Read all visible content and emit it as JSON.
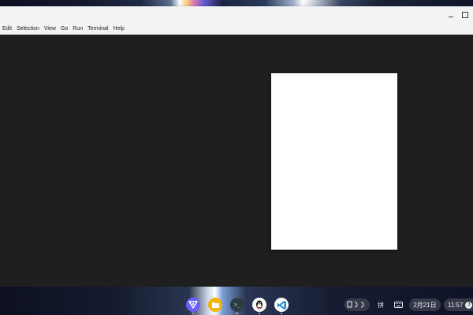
{
  "window": {
    "controls": {
      "minimize_glyph": "_",
      "maximize_icon": "maximize-icon"
    }
  },
  "menu_bar": {
    "items": [
      {
        "label": "Edit"
      },
      {
        "label": "Selection"
      },
      {
        "label": "View"
      },
      {
        "label": "Go"
      },
      {
        "label": "Run"
      },
      {
        "label": "Terminal"
      },
      {
        "label": "Help"
      }
    ]
  },
  "colors": {
    "editor_background": "#1f1f1f",
    "title_bar": "#f1f3f4",
    "page_preview": "#ffffff"
  },
  "shelf": {
    "apps": [
      {
        "name": "app-launcher-icon",
        "color": "#6b5cff"
      },
      {
        "name": "files-icon",
        "color": "#f6b400"
      },
      {
        "name": "terminal-icon",
        "color": "#2d3b44",
        "glyph": ">_"
      },
      {
        "name": "qq-icon",
        "color": "#ffffff"
      },
      {
        "name": "vscode-icon",
        "color": "#1e8ad6"
      }
    ],
    "tray": {
      "clipboard_icons": "clipboard-icon",
      "ime_glyph": "拼",
      "keyboard_icon": "keyboard-icon",
      "date": "2月21日",
      "time": "11:57",
      "notification_count": "3"
    }
  }
}
